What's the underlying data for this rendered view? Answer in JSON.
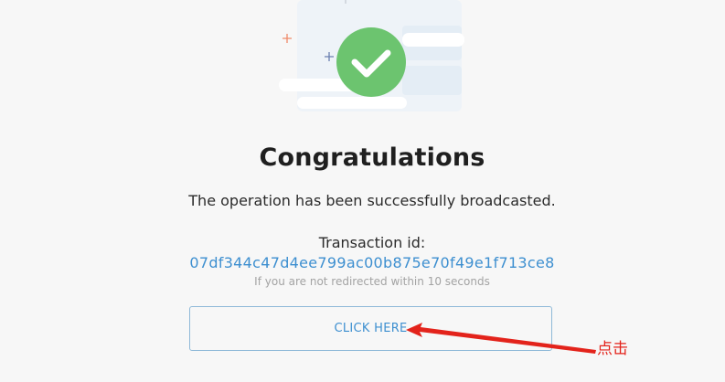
{
  "title": "Congratulations",
  "message": "The operation has been successfully broadcasted.",
  "transaction": {
    "label": "Transaction id:",
    "id": "07df344c47d4ee799ac00b875e70f49e1f713ce8"
  },
  "redirect_notice": "If you are not redirected within 10 seconds",
  "button": {
    "label": "CLICK HERE"
  },
  "annotation": {
    "text": "点击"
  },
  "colors": {
    "success": "#6cc46f",
    "link": "#3d8fd0",
    "annotation": "#e3231b",
    "button_border": "#8fb9d8"
  },
  "icons": [
    "success-checkmark-icon",
    "sparkle-icon"
  ]
}
